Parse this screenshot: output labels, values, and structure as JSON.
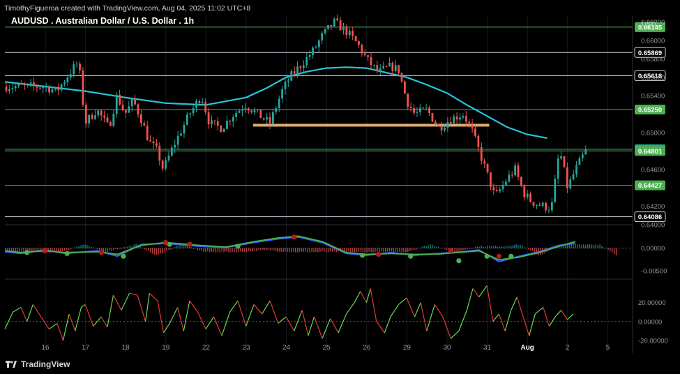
{
  "header": {
    "attribution": "TimothyFigueroa created with TradingView.com, Aug 04, 2025 11:02 UTC+8",
    "symbol_title": "AUDUSD . Australian Dollar / U.S. Dollar . 1h",
    "currency": "USD"
  },
  "footer": {
    "brand": "TradingView"
  },
  "colors": {
    "background": "#000000",
    "up": "#26a69a",
    "down": "#ef5350",
    "ma": "#26c6da",
    "hline_green": "#4caf50",
    "zone": "#f5c07a",
    "macd_line": "#2962ff",
    "signal_line": "#4caf50",
    "cross_up": "#4caf50",
    "cross_down": "#b71c1c",
    "osc_up": "#66dd55",
    "osc_down": "#e53935"
  },
  "chart_data": [
    {
      "type": "candlestick",
      "title": "AUDUSD . Australian Dollar / U.S. Dollar . 1h",
      "x_ticks": [
        "16",
        "17",
        "18",
        "19",
        "22",
        "23",
        "24",
        "25",
        "26",
        "29",
        "30",
        "31",
        "Aug",
        "2",
        "5"
      ],
      "y_ticks": [
        "0.66200",
        "0.66000",
        "0.65800",
        "0.65600",
        "0.65400",
        "0.65000",
        "0.64600",
        "0.64200",
        "0.64000"
      ],
      "ylim": [
        0.64,
        0.6625
      ],
      "price_levels": [
        {
          "value": 0.66145,
          "label": "0.66145",
          "color": "#4caf50"
        },
        {
          "value": 0.65869,
          "label": "0.65869",
          "color": "#d1d4dc"
        },
        {
          "value": 0.65618,
          "label": "0.65618",
          "color": "#d1d4dc"
        },
        {
          "value": 0.6525,
          "label": "0.65250",
          "color": "#4caf50"
        },
        {
          "value": 0.64818,
          "label": "0.64818",
          "color": "#26a69a"
        },
        {
          "value": 0.64801,
          "label": "0.64801",
          "color": "#4caf50"
        },
        {
          "value": 0.64427,
          "label": "0.64427",
          "color": "#4caf50"
        },
        {
          "value": 0.64086,
          "label": "0.64086",
          "color": "#d1d4dc"
        }
      ],
      "zone": {
        "from_x": 5.17,
        "to_x": 11.05,
        "value": 0.6508
      },
      "series": [
        {
          "name": "close",
          "points": [
            [
              0,
              0.655
            ],
            [
              0.3,
              0.6545
            ],
            [
              0.55,
              0.656
            ],
            [
              0.8,
              0.6575
            ],
            [
              0.9,
              0.656
            ],
            [
              1.0,
              0.651
            ],
            [
              1.3,
              0.6525
            ],
            [
              1.6,
              0.6505
            ],
            [
              1.8,
              0.654
            ],
            [
              2.0,
              0.652
            ],
            [
              2.2,
              0.6535
            ],
            [
              2.4,
              0.6515
            ],
            [
              2.6,
              0.649
            ],
            [
              2.8,
              0.648
            ],
            [
              2.95,
              0.646
            ],
            [
              3.2,
              0.6485
            ],
            [
              3.6,
              0.652
            ],
            [
              3.9,
              0.654
            ],
            [
              4.1,
              0.651
            ],
            [
              4.4,
              0.6505
            ],
            [
              4.7,
              0.652
            ],
            [
              5.0,
              0.653
            ],
            [
              5.3,
              0.652
            ],
            [
              5.6,
              0.651
            ],
            [
              5.9,
              0.6545
            ],
            [
              6.1,
              0.656
            ],
            [
              6.4,
              0.6575
            ],
            [
              6.7,
              0.659
            ],
            [
              6.9,
              0.6605
            ],
            [
              7.2,
              0.662
            ],
            [
              7.5,
              0.661
            ],
            [
              7.8,
              0.6595
            ],
            [
              8.0,
              0.658
            ],
            [
              8.3,
              0.6565
            ],
            [
              8.6,
              0.6572
            ],
            [
              8.8,
              0.6568
            ],
            [
              9.0,
              0.6535
            ],
            [
              9.2,
              0.652
            ],
            [
              9.5,
              0.6525
            ],
            [
              9.8,
              0.6505
            ],
            [
              10.1,
              0.6515
            ],
            [
              10.4,
              0.652
            ],
            [
              10.6,
              0.6505
            ],
            [
              10.8,
              0.648
            ],
            [
              11.0,
              0.6455
            ],
            [
              11.2,
              0.643
            ],
            [
              11.5,
              0.645
            ],
            [
              11.7,
              0.646
            ],
            [
              11.9,
              0.6435
            ],
            [
              12.1,
              0.6425
            ],
            [
              12.4,
              0.642
            ],
            [
              12.6,
              0.6418
            ],
            [
              12.8,
              0.6482
            ],
            [
              13.0,
              0.644
            ],
            [
              13.2,
              0.646
            ],
            [
              13.45,
              0.648
            ]
          ]
        },
        {
          "name": "moving_average",
          "points": [
            [
              0,
              0.6555
            ],
            [
              1,
              0.655
            ],
            [
              2,
              0.6545
            ],
            [
              3,
              0.6538
            ],
            [
              4,
              0.6532
            ],
            [
              5,
              0.653
            ],
            [
              6,
              0.6538
            ],
            [
              6.5,
              0.6548
            ],
            [
              7,
              0.656
            ],
            [
              7.5,
              0.6566
            ],
            [
              8,
              0.657
            ],
            [
              8.5,
              0.6571
            ],
            [
              9,
              0.657
            ],
            [
              9.5,
              0.6565
            ],
            [
              10,
              0.656
            ],
            [
              10.5,
              0.6552
            ],
            [
              11,
              0.6543
            ],
            [
              11.5,
              0.653
            ],
            [
              12,
              0.6518
            ],
            [
              12.5,
              0.6506
            ],
            [
              13,
              0.6498
            ],
            [
              13.5,
              0.6494
            ]
          ]
        }
      ]
    },
    {
      "type": "line",
      "y_ticks": [
        "0.00000",
        "-0.00500"
      ],
      "ylim": [
        -0.0065,
        0.0045
      ],
      "series": [
        {
          "name": "macd",
          "points": [
            [
              0,
              -0.0008
            ],
            [
              0.4,
              -0.0012
            ],
            [
              1.0,
              -0.0004
            ],
            [
              1.5,
              -0.0012
            ],
            [
              2.3,
              -0.0006
            ],
            [
              2.8,
              -0.0018
            ],
            [
              3.4,
              0.0008
            ],
            [
              4.0,
              0.001
            ],
            [
              4.8,
              0.0004
            ],
            [
              5.5,
              0.0001
            ],
            [
              6.2,
              0.0012
            ],
            [
              6.8,
              0.002
            ],
            [
              7.3,
              0.0024
            ],
            [
              7.9,
              0.0012
            ],
            [
              8.5,
              -0.0012
            ],
            [
              9.0,
              -0.0016
            ],
            [
              9.6,
              -0.001
            ],
            [
              10.2,
              -0.0016
            ],
            [
              10.8,
              -0.0012
            ],
            [
              11.4,
              -0.0008
            ],
            [
              11.8,
              -0.0004
            ],
            [
              12.3,
              -0.003
            ],
            [
              12.8,
              -0.0018
            ],
            [
              13.3,
              -0.0008
            ],
            [
              13.8,
              0.0006
            ],
            [
              14.2,
              0.001
            ]
          ]
        },
        {
          "name": "signal",
          "points": [
            [
              0,
              -0.0006
            ],
            [
              0.4,
              -0.001
            ],
            [
              1.0,
              -0.0006
            ],
            [
              1.5,
              -0.001
            ],
            [
              2.3,
              -0.0008
            ],
            [
              2.8,
              -0.0014
            ],
            [
              3.4,
              0.0006
            ],
            [
              4.0,
              0.0012
            ],
            [
              4.8,
              0.0006
            ],
            [
              5.5,
              0.0002
            ],
            [
              6.2,
              0.0014
            ],
            [
              6.8,
              0.0022
            ],
            [
              7.3,
              0.0026
            ],
            [
              7.9,
              0.0014
            ],
            [
              8.5,
              -0.001
            ],
            [
              9.0,
              -0.0014
            ],
            [
              9.6,
              -0.0012
            ],
            [
              10.2,
              -0.0014
            ],
            [
              10.8,
              -0.0013
            ],
            [
              11.4,
              -0.0009
            ],
            [
              11.8,
              -0.0006
            ],
            [
              12.3,
              -0.0026
            ],
            [
              12.8,
              -0.002
            ],
            [
              13.3,
              -0.001
            ],
            [
              13.8,
              0.0004
            ],
            [
              14.2,
              0.0014
            ]
          ]
        },
        {
          "name": "crossovers_bull",
          "points": [
            [
              0.55,
              -0.001
            ],
            [
              1.55,
              -0.0012
            ],
            [
              2.95,
              -0.0018
            ],
            [
              4.1,
              0.0008
            ],
            [
              5.8,
              0.0004
            ],
            [
              8.9,
              -0.0016
            ],
            [
              10.1,
              -0.0018
            ],
            [
              11.3,
              -0.0028
            ],
            [
              12.0,
              -0.0018
            ],
            [
              12.6,
              -0.0018
            ]
          ]
        },
        {
          "name": "crossovers_bear",
          "points": [
            [
              1.0,
              -0.0006
            ],
            [
              2.4,
              -0.001
            ],
            [
              4.0,
              0.0012
            ],
            [
              4.6,
              0.0008
            ],
            [
              7.2,
              0.0024
            ],
            [
              9.3,
              -0.0014
            ],
            [
              11.1,
              -0.0006
            ],
            [
              12.3,
              -0.0018
            ]
          ]
        }
      ]
    },
    {
      "type": "line",
      "y_ticks": [
        "20.00000",
        "0.00000",
        "-20.00000"
      ],
      "ylim": [
        -32,
        42
      ],
      "series": [
        {
          "name": "oscillator",
          "points": [
            [
              0,
              -8
            ],
            [
              0.2,
              10
            ],
            [
              0.4,
              15
            ],
            [
              0.55,
              0
            ],
            [
              0.7,
              18
            ],
            [
              0.9,
              5
            ],
            [
              1.1,
              -8
            ],
            [
              1.3,
              -2
            ],
            [
              1.45,
              -20
            ],
            [
              1.6,
              8
            ],
            [
              1.75,
              -10
            ],
            [
              1.9,
              15
            ],
            [
              2.0,
              18
            ],
            [
              2.2,
              -5
            ],
            [
              2.4,
              5
            ],
            [
              2.55,
              -6
            ],
            [
              2.7,
              28
            ],
            [
              2.9,
              12
            ],
            [
              3.1,
              30
            ],
            [
              3.3,
              28
            ],
            [
              3.5,
              0
            ],
            [
              3.6,
              30
            ],
            [
              3.8,
              22
            ],
            [
              3.95,
              -12
            ],
            [
              4.1,
              -2
            ],
            [
              4.3,
              15
            ],
            [
              4.45,
              -10
            ],
            [
              4.6,
              22
            ],
            [
              4.8,
              10
            ],
            [
              5.0,
              -8
            ],
            [
              5.2,
              5
            ],
            [
              5.4,
              -15
            ],
            [
              5.6,
              10
            ],
            [
              5.8,
              22
            ],
            [
              6.0,
              -5
            ],
            [
              6.2,
              18
            ],
            [
              6.4,
              8
            ],
            [
              6.6,
              22
            ],
            [
              6.8,
              -2
            ],
            [
              7.0,
              5
            ],
            [
              7.2,
              -10
            ],
            [
              7.4,
              12
            ],
            [
              7.55,
              -15
            ],
            [
              7.7,
              5
            ],
            [
              7.9,
              -18
            ],
            [
              8.1,
              3
            ],
            [
              8.3,
              -12
            ],
            [
              8.5,
              8
            ],
            [
              8.7,
              20
            ],
            [
              8.85,
              32
            ],
            [
              9.0,
              20
            ],
            [
              9.1,
              35
            ],
            [
              9.25,
              0
            ],
            [
              9.45,
              -12
            ],
            [
              9.6,
              5
            ],
            [
              9.8,
              18
            ],
            [
              10.0,
              25
            ],
            [
              10.2,
              5
            ],
            [
              10.35,
              20
            ],
            [
              10.5,
              -10
            ],
            [
              10.7,
              18
            ],
            [
              10.9,
              5
            ],
            [
              11.1,
              -18
            ],
            [
              11.3,
              -10
            ],
            [
              11.5,
              12
            ],
            [
              11.65,
              35
            ],
            [
              11.8,
              26
            ],
            [
              12.0,
              38
            ],
            [
              12.15,
              0
            ],
            [
              12.3,
              8
            ],
            [
              12.45,
              -10
            ],
            [
              12.6,
              12
            ],
            [
              12.75,
              26
            ],
            [
              12.9,
              5
            ],
            [
              13.05,
              -15
            ],
            [
              13.2,
              8
            ],
            [
              13.4,
              15
            ],
            [
              13.55,
              -5
            ],
            [
              13.7,
              5
            ],
            [
              13.85,
              12
            ],
            [
              14.0,
              2
            ],
            [
              14.15,
              8
            ]
          ]
        }
      ]
    }
  ]
}
